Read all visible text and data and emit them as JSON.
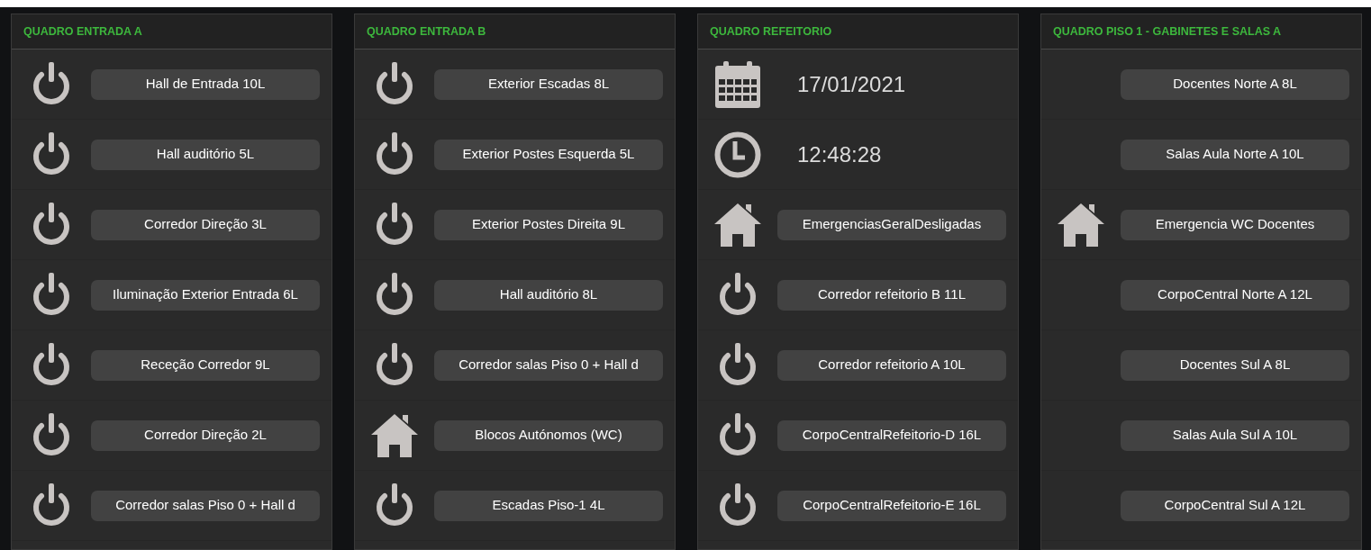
{
  "panels": [
    {
      "title": "QUADRO ENTRADA A",
      "rows": [
        {
          "kind": "power",
          "label": "Hall de Entrada 10L"
        },
        {
          "kind": "power",
          "label": "Hall auditório 5L"
        },
        {
          "kind": "power",
          "label": "Corredor Direção 3L"
        },
        {
          "kind": "power",
          "label": "Iluminação Exterior Entrada 6L"
        },
        {
          "kind": "power",
          "label": "Receção Corredor 9L"
        },
        {
          "kind": "power",
          "label": "Corredor Direção 2L"
        },
        {
          "kind": "power",
          "label": "Corredor salas Piso 0 + Hall d"
        }
      ]
    },
    {
      "title": "QUADRO ENTRADA B",
      "rows": [
        {
          "kind": "power",
          "label": "Exterior Escadas  8L"
        },
        {
          "kind": "power",
          "label": "Exterior Postes Esquerda 5L"
        },
        {
          "kind": "power",
          "label": "Exterior Postes Direita 9L"
        },
        {
          "kind": "power",
          "label": "Hall auditório 8L"
        },
        {
          "kind": "power",
          "label": "Corredor salas Piso 0 + Hall d"
        },
        {
          "kind": "home",
          "label": "Blocos Autónomos (WC)"
        },
        {
          "kind": "power",
          "label": "Escadas Piso-1 4L"
        }
      ]
    },
    {
      "title": "QUADRO REFEITORIO",
      "rows": [
        {
          "kind": "date",
          "value": "17/01/2021"
        },
        {
          "kind": "time",
          "value": "12:48:28"
        },
        {
          "kind": "home",
          "label": "EmergenciasGeralDesligadas"
        },
        {
          "kind": "power",
          "label": "Corredor refeitorio B 11L"
        },
        {
          "kind": "power",
          "label": "Corredor refeitorio A 10L"
        },
        {
          "kind": "power",
          "label": "CorpoCentralRefeitorio-D 16L"
        },
        {
          "kind": "power",
          "label": "CorpoCentralRefeitorio-E 16L"
        }
      ]
    },
    {
      "title": "QUADRO PISO 1 - GABINETES E SALAS A",
      "rows": [
        {
          "kind": "plain",
          "label": "Docentes Norte A 8L"
        },
        {
          "kind": "plain",
          "label": "Salas Aula Norte A 10L"
        },
        {
          "kind": "home",
          "label": "Emergencia WC Docentes"
        },
        {
          "kind": "plain",
          "label": "CorpoCentral Norte A 12L"
        },
        {
          "kind": "plain",
          "label": "Docentes Sul A 8L"
        },
        {
          "kind": "plain",
          "label": "Salas Aula Sul A 10L"
        },
        {
          "kind": "plain",
          "label": "CorpoCentral Sul A 12L"
        }
      ]
    }
  ]
}
